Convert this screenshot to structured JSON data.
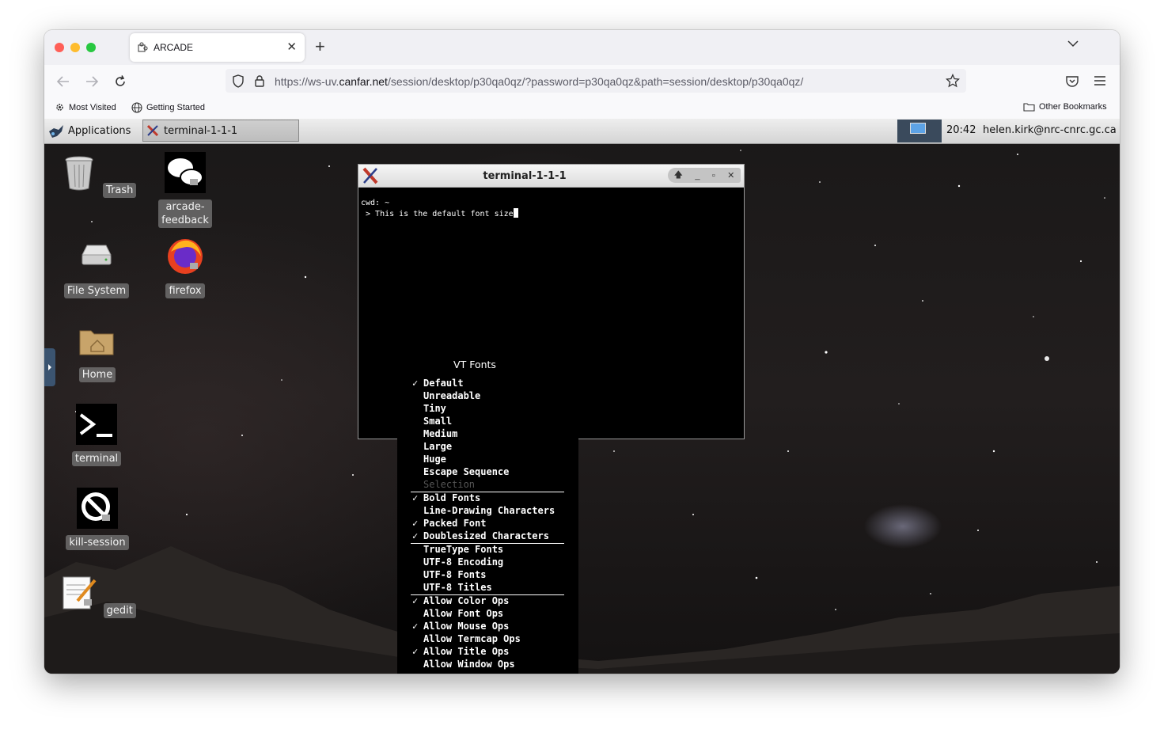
{
  "browser": {
    "tab_title": "ARCADE",
    "url_prefix": "https://ws-uv.",
    "url_domain": "canfar.net",
    "url_rest": "/session/desktop/p30qa0qz/?password=p30qa0qz&path=session/desktop/p30qa0qz/",
    "bookmarks": {
      "most_visited": "Most Visited",
      "getting_started": "Getting Started",
      "other": "Other Bookmarks"
    }
  },
  "panel": {
    "applications": "Applications",
    "task": "terminal-1-1-1",
    "clock": "20:42",
    "user": "helen.kirk@nrc-cnrc.gc.ca"
  },
  "desktop_icons": {
    "trash": "Trash",
    "arcade_feedback_1": "arcade-",
    "arcade_feedback_2": "feedback",
    "file_system": "File System",
    "firefox": "firefox",
    "home": "Home",
    "terminal": "terminal",
    "kill_session": "kill-session",
    "gedit": "gedit"
  },
  "xterm": {
    "title": "terminal-1-1-1",
    "line1": "cwd: ~",
    "line2": " > This is the default font size"
  },
  "vt_menu": {
    "title": "VT Fonts",
    "items": [
      {
        "label": "Default",
        "checked": true
      },
      {
        "label": "Unreadable",
        "checked": false
      },
      {
        "label": "Tiny",
        "checked": false
      },
      {
        "label": "Small",
        "checked": false
      },
      {
        "label": "Medium",
        "checked": false
      },
      {
        "label": "Large",
        "checked": false
      },
      {
        "label": "Huge",
        "checked": false
      },
      {
        "label": "Escape Sequence",
        "checked": false
      },
      {
        "label": "Selection",
        "checked": false,
        "disabled": true
      },
      {
        "label": "Bold Fonts",
        "checked": true
      },
      {
        "label": "Line-Drawing Characters",
        "checked": false
      },
      {
        "label": "Packed Font",
        "checked": true
      },
      {
        "label": "Doublesized Characters",
        "checked": true
      },
      {
        "label": "TrueType Fonts",
        "checked": false
      },
      {
        "label": "UTF-8 Encoding",
        "checked": false
      },
      {
        "label": "UTF-8 Fonts",
        "checked": false
      },
      {
        "label": "UTF-8 Titles",
        "checked": false
      },
      {
        "label": "Allow Color Ops",
        "checked": true
      },
      {
        "label": "Allow Font Ops",
        "checked": false
      },
      {
        "label": "Allow Mouse Ops",
        "checked": true
      },
      {
        "label": "Allow Termcap Ops",
        "checked": false
      },
      {
        "label": "Allow Title Ops",
        "checked": true
      },
      {
        "label": "Allow Window Ops",
        "checked": false
      }
    ],
    "check_glyph": "✓"
  },
  "icons": {
    "back": "back-arrow-icon",
    "forward": "forward-arrow-icon",
    "reload": "reload-icon"
  }
}
